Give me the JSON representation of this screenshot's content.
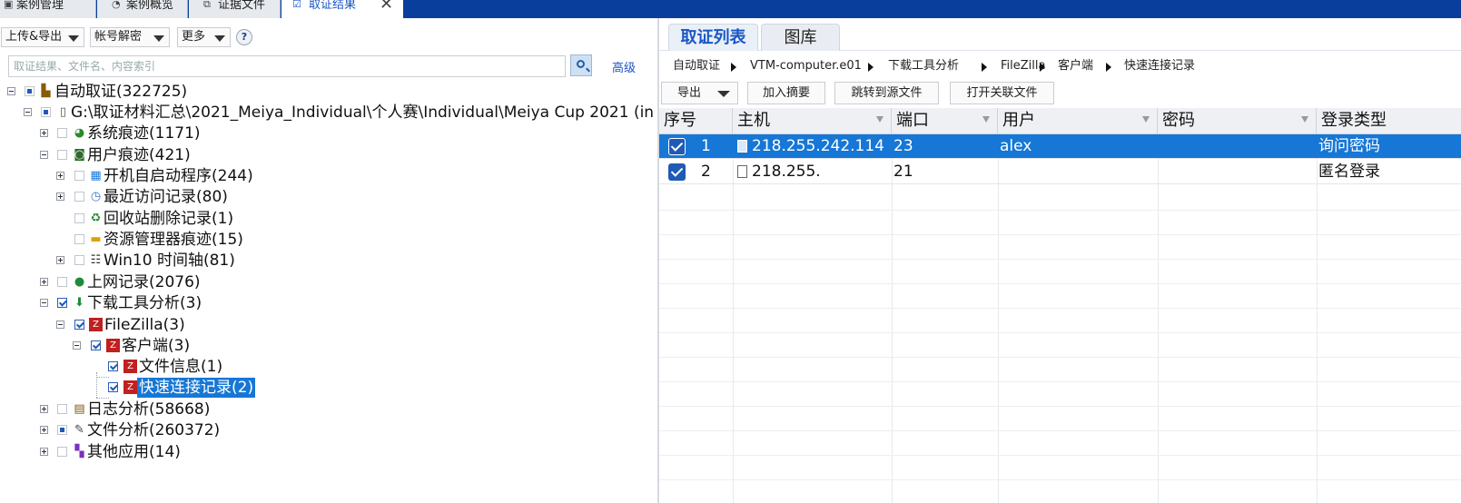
{
  "top_tabs": [
    {
      "label": "案例管理",
      "icon": "briefcase-icon"
    },
    {
      "label": "案例概览",
      "icon": "overview-icon"
    },
    {
      "label": "证据文件",
      "icon": "evidence-file-icon"
    },
    {
      "label": "取证结果",
      "icon": "result-icon",
      "active": true
    }
  ],
  "close_glyph": "✕",
  "toolbar": {
    "upload_export": "上传&导出",
    "account_decrypt": "帐号解密",
    "more": "更多",
    "help": "?"
  },
  "search": {
    "placeholder": "取证结果、文件名、内容索引",
    "advanced": "高级"
  },
  "tree": {
    "root": "自动取证(322725)",
    "evidence": "G:\\取证材料汇总\\2021_Meiya_Individual\\个人赛\\Individual\\Meiya Cup 2021 (in",
    "system_traces": "系统痕迹(1171)",
    "user_traces": "用户痕迹(421)",
    "startup": "开机自启动程序(244)",
    "recent": "最近访问记录(80)",
    "recycle": "回收站删除记录(1)",
    "explorer": "资源管理器痕迹(15)",
    "timeline": "Win10 时间轴(81)",
    "internet": "上网记录(2076)",
    "download": "下载工具分析(3)",
    "filezilla": "FileZilla(3)",
    "client": "客户端(3)",
    "file_info": "文件信息(1)",
    "quick_connect": "快速连接记录(2)",
    "logs": "日志分析(58668)",
    "file_analysis": "文件分析(260372)",
    "other_apps": "其他应用(14)"
  },
  "right_tabs": {
    "list": "取证列表",
    "gallery": "图库"
  },
  "breadcrumb": [
    "自动取证",
    "VTM-computer.e01",
    "下载工具分析",
    "FileZilla",
    "客户端",
    "快速连接记录"
  ],
  "actions": {
    "export": "导出",
    "add_summary": "加入摘要",
    "goto_source": "跳转到源文件",
    "open_related": "打开关联文件"
  },
  "table": {
    "columns": [
      "序号",
      "主机",
      "端口",
      "用户",
      "密码",
      "登录类型"
    ],
    "rows": [
      {
        "index": "1",
        "host": "218.255.242.114",
        "port": "23",
        "user": "alex",
        "password": "",
        "login_type": "询问密码",
        "selected": true,
        "checked": true
      },
      {
        "index": "2",
        "host": "218.255.",
        "port": "21",
        "user": "",
        "password": "",
        "login_type": "匿名登录",
        "selected": false,
        "checked": true
      }
    ]
  },
  "colors": {
    "top_bar": "#0a3e9c",
    "accent": "#1a56c4",
    "selection": "#1677d6",
    "check": "#1f5ab5"
  }
}
